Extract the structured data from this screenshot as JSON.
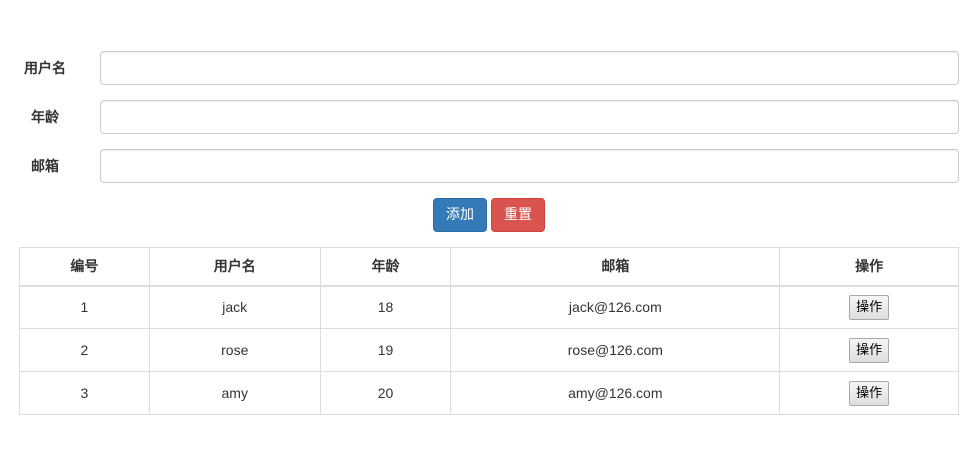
{
  "form": {
    "username_label": "用户名",
    "username_value": "",
    "age_label": "年龄",
    "age_value": "",
    "email_label": "邮箱",
    "email_value": "",
    "add_label": "添加",
    "reset_label": "重置"
  },
  "table": {
    "headers": [
      "编号",
      "用户名",
      "年龄",
      "邮箱",
      "操作"
    ],
    "rows": [
      {
        "id": "1",
        "name": "jack",
        "age": "18",
        "email": "jack@126.com",
        "op": "操作"
      },
      {
        "id": "2",
        "name": "rose",
        "age": "19",
        "email": "rose@126.com",
        "op": "操作"
      },
      {
        "id": "3",
        "name": "amy",
        "age": "20",
        "email": "amy@126.com",
        "op": "操作"
      }
    ]
  },
  "colors": {
    "primary": "#337ab7",
    "danger": "#d9534f",
    "border": "#dddddd"
  }
}
